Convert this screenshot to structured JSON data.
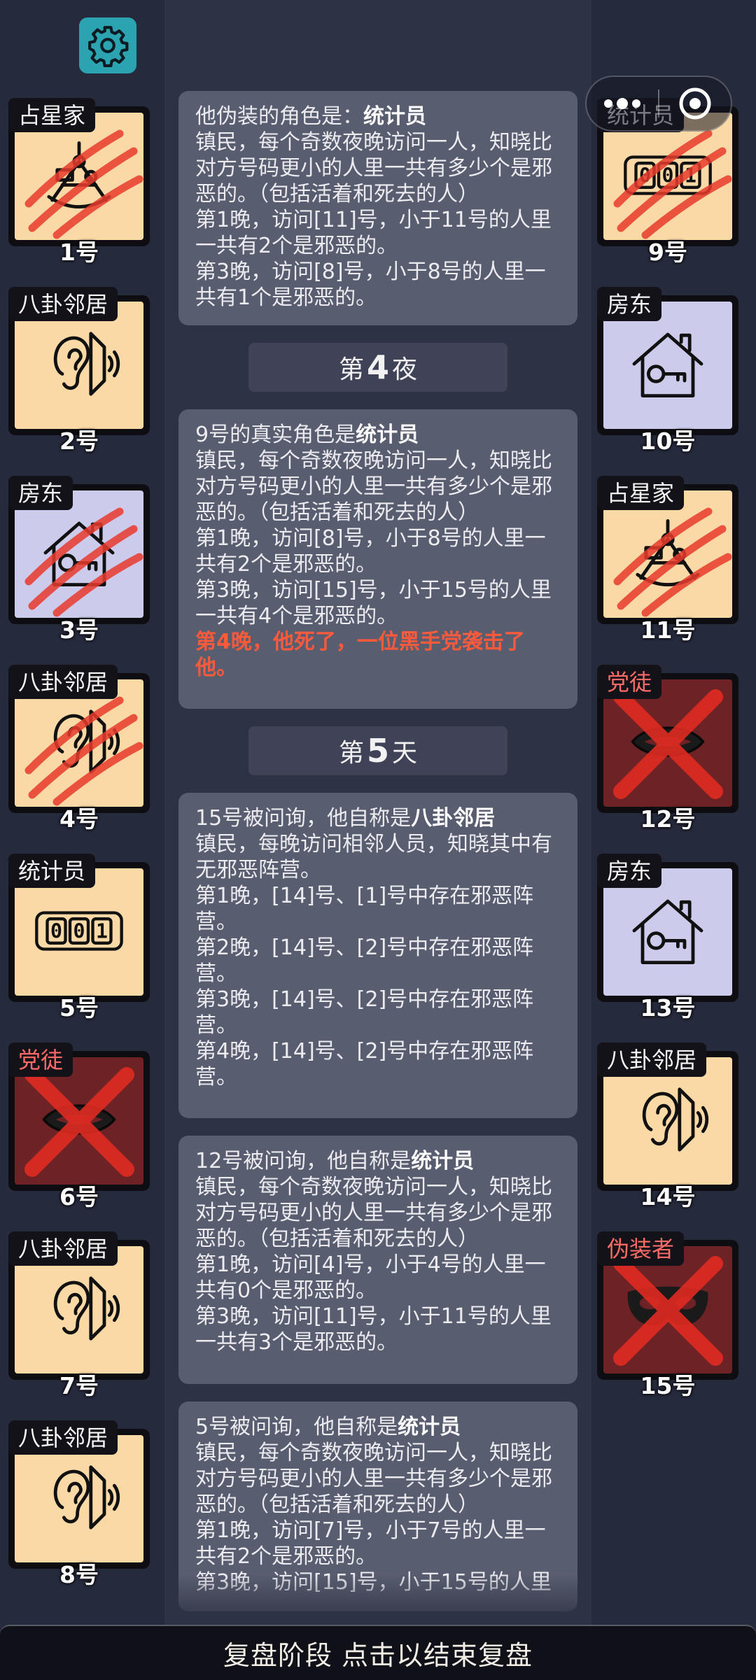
{
  "settings": {
    "icon": "gear-icon",
    "color": "#2ba3b0"
  },
  "capsule": {
    "menu_icon": "more-dots-icon",
    "close_icon": "target-icon"
  },
  "players": [
    {
      "num": "1号",
      "role": "占星家",
      "type": "good",
      "icon": "sextant-icon",
      "dead": "claw",
      "side": "left",
      "slot": 0
    },
    {
      "num": "2号",
      "role": "八卦邻居",
      "type": "good",
      "icon": "ear-icon",
      "dead": "",
      "side": "left",
      "slot": 1
    },
    {
      "num": "3号",
      "role": "房东",
      "type": "landlord",
      "icon": "house-key-icon",
      "dead": "claw",
      "side": "left",
      "slot": 2
    },
    {
      "num": "4号",
      "role": "八卦邻居",
      "type": "good",
      "icon": "ear-icon",
      "dead": "claw",
      "side": "left",
      "slot": 3
    },
    {
      "num": "5号",
      "role": "统计员",
      "type": "good",
      "icon": "counter-icon",
      "dead": "",
      "side": "left",
      "slot": 4
    },
    {
      "num": "6号",
      "role": "党徒",
      "type": "evil",
      "icon": "mouth-icon",
      "dead": "x",
      "side": "left",
      "slot": 5
    },
    {
      "num": "7号",
      "role": "八卦邻居",
      "type": "good",
      "icon": "ear-icon",
      "dead": "",
      "side": "left",
      "slot": 6
    },
    {
      "num": "8号",
      "role": "八卦邻居",
      "type": "good",
      "icon": "ear-icon",
      "dead": "",
      "side": "left",
      "slot": 7
    },
    {
      "num": "9号",
      "role": "统计员",
      "type": "good",
      "icon": "counter-icon",
      "dead": "claw",
      "side": "right",
      "slot": 0
    },
    {
      "num": "10号",
      "role": "房东",
      "type": "landlord",
      "icon": "house-key-icon",
      "dead": "",
      "side": "right",
      "slot": 1
    },
    {
      "num": "11号",
      "role": "占星家",
      "type": "good",
      "icon": "sextant-icon",
      "dead": "claw",
      "side": "right",
      "slot": 2
    },
    {
      "num": "12号",
      "role": "党徒",
      "type": "evil",
      "icon": "mouth-icon",
      "dead": "x",
      "side": "right",
      "slot": 3
    },
    {
      "num": "13号",
      "role": "房东",
      "type": "landlord",
      "icon": "house-key-icon",
      "dead": "",
      "side": "right",
      "slot": 4
    },
    {
      "num": "14号",
      "role": "八卦邻居",
      "type": "good",
      "icon": "ear-icon",
      "dead": "",
      "side": "right",
      "slot": 5
    },
    {
      "num": "15号",
      "role": "伪装者",
      "type": "evil",
      "icon": "mask-icon",
      "dead": "x",
      "side": "right",
      "slot": 6
    }
  ],
  "log": {
    "msg1": {
      "head": "他伪装的角色是：",
      "role": "统计员",
      "lines": [
        "镇民，每个奇数夜晚访问一人，知晓比对方号码更小的人里一共有多少个是邪恶的。（包括活着和死去的人）",
        "第1晚，访问[11]号，小于11号的人里一共有2个是邪恶的。",
        "第3晚，访问[8]号，小于8号的人里一共有1个是邪恶的。"
      ]
    },
    "phase1": {
      "pre": "第",
      "num": "4",
      "post": "夜"
    },
    "msg2": {
      "head": "9号的真实角色是",
      "role": "统计员",
      "lines": [
        "镇民，每个奇数夜晚访问一人，知晓比对方号码更小的人里一共有多少个是邪恶的。（包括活着和死去的人）",
        "第1晚，访问[8]号，小于8号的人里一共有2个是邪恶的。",
        "第3晚，访问[15]号，小于15号的人里一共有4个是邪恶的。"
      ],
      "death": "第4晚，他死了，一位黑手党袭击了他。"
    },
    "phase2": {
      "pre": "第",
      "num": "5",
      "post": "天"
    },
    "msg3": {
      "head": "15号被问询，他自称是",
      "role": "八卦邻居",
      "lines": [
        "镇民，每晚访问相邻人员，知晓其中有无邪恶阵营。",
        "第1晚，[14]号、[1]号中存在邪恶阵营。",
        "第2晚，[14]号、[2]号中存在邪恶阵营。",
        "第3晚，[14]号、[2]号中存在邪恶阵营。",
        "第4晚，[14]号、[2]号中存在邪恶阵营。"
      ]
    },
    "msg4": {
      "head": "12号被问询，他自称是",
      "role": "统计员",
      "lines": [
        "镇民，每个奇数夜晚访问一人，知晓比对方号码更小的人里一共有多少个是邪恶的。（包括活着和死去的人）",
        "第1晚，访问[4]号，小于4号的人里一共有0个是邪恶的。",
        "第3晚，访问[11]号，小于11号的人里一共有3个是邪恶的。"
      ]
    },
    "msg5": {
      "head": "5号被问询，他自称是",
      "role": "统计员",
      "lines": [
        "镇民，每个奇数夜晚访问一人，知晓比对方号码更小的人里一共有多少个是邪恶的。（包括活着和死去的人）",
        "第1晚，访问[7]号，小于7号的人里一共有2个是邪恶的。",
        "第3晚，访问[15]号，小于15号的人里"
      ]
    }
  },
  "bottom_button": "复盘阶段 点击以结束复盘"
}
